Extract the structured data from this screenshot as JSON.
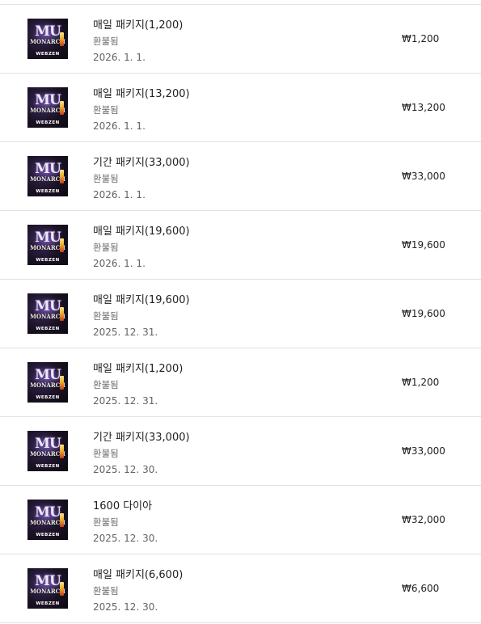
{
  "purchases": [
    {
      "title": "매일 패키지(1,200)",
      "status": "환불됨",
      "date": "2026. 1. 1.",
      "price": "₩1,200"
    },
    {
      "title": "매일 패키지(13,200)",
      "status": "환불됨",
      "date": "2026. 1. 1.",
      "price": "₩13,200"
    },
    {
      "title": "기간 패키지(33,000)",
      "status": "환불됨",
      "date": "2026. 1. 1.",
      "price": "₩33,000"
    },
    {
      "title": "매일 패키지(19,600)",
      "status": "환불됨",
      "date": "2026. 1. 1.",
      "price": "₩19,600"
    },
    {
      "title": "매일 패키지(19,600)",
      "status": "환불됨",
      "date": "2025. 12. 31.",
      "price": "₩19,600"
    },
    {
      "title": "매일 패키지(1,200)",
      "status": "환불됨",
      "date": "2025. 12. 31.",
      "price": "₩1,200"
    },
    {
      "title": "기간 패키지(33,000)",
      "status": "환불됨",
      "date": "2025. 12. 30.",
      "price": "₩33,000"
    },
    {
      "title": "1600 다이아",
      "status": "환불됨",
      "date": "2025. 12. 30.",
      "price": "₩32,000"
    },
    {
      "title": "매일 패키지(6,600)",
      "status": "환불됨",
      "date": "2025. 12. 30.",
      "price": "₩6,600"
    }
  ],
  "app_icon": {
    "name": "mu-monarch-2-app-icon",
    "logo_text": "MU",
    "subtitle_text": "MONARCH",
    "publisher_text": "WEBZEN"
  }
}
